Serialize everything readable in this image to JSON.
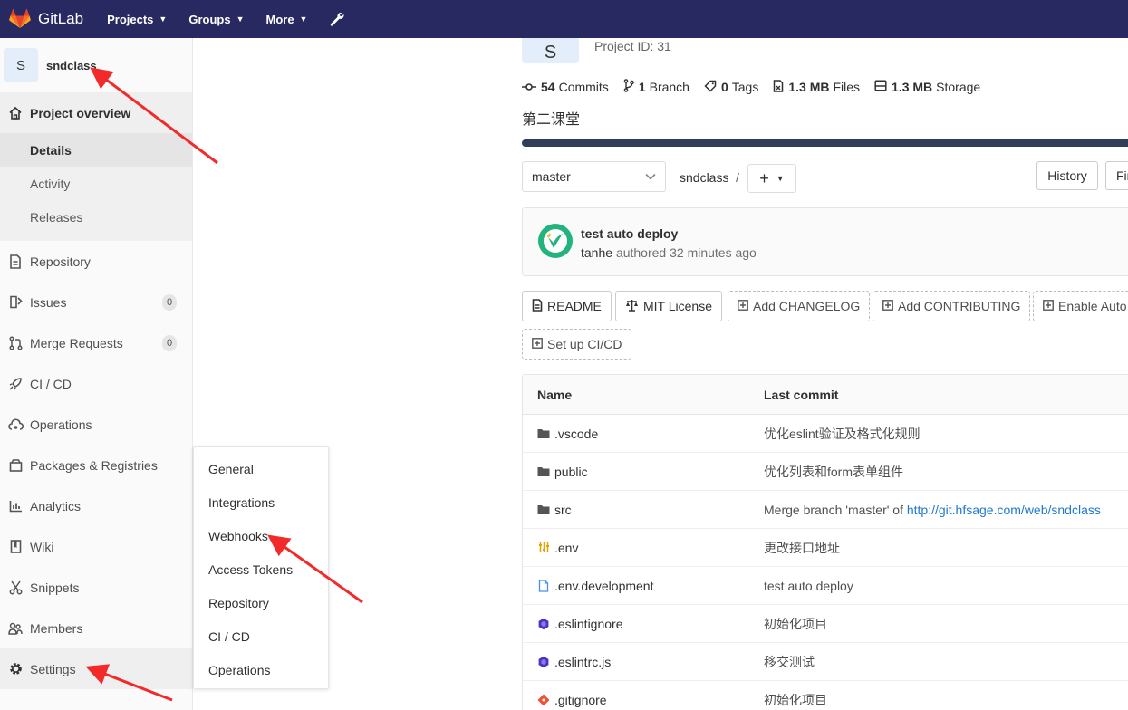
{
  "navbar": {
    "brand": "GitLab",
    "items": [
      {
        "label": "Projects"
      },
      {
        "label": "Groups"
      },
      {
        "label": "More"
      }
    ],
    "admin_icon": "wrench-icon"
  },
  "sidebar": {
    "avatar_letter": "S",
    "project_name": "sndclass",
    "overview": {
      "label": "Project overview",
      "subitems": [
        "Details",
        "Activity",
        "Releases"
      ]
    },
    "items": [
      {
        "label": "Repository",
        "icon": "document-icon"
      },
      {
        "label": "Issues",
        "icon": "issues-icon",
        "badge": "0"
      },
      {
        "label": "Merge Requests",
        "icon": "merge-request-icon",
        "badge": "0"
      },
      {
        "label": "CI / CD",
        "icon": "rocket-icon"
      },
      {
        "label": "Operations",
        "icon": "cloud-gear-icon"
      },
      {
        "label": "Packages & Registries",
        "icon": "package-icon"
      },
      {
        "label": "Analytics",
        "icon": "chart-icon"
      },
      {
        "label": "Wiki",
        "icon": "book-icon"
      },
      {
        "label": "Snippets",
        "icon": "scissors-icon"
      },
      {
        "label": "Members",
        "icon": "users-icon"
      },
      {
        "label": "Settings",
        "icon": "gear-icon"
      }
    ]
  },
  "settings_flyout": [
    "General",
    "Integrations",
    "Webhooks",
    "Access Tokens",
    "Repository",
    "CI / CD",
    "Operations"
  ],
  "project": {
    "avatar_letter": "S",
    "id_text": "Project ID: 31",
    "stats": [
      {
        "value": "54",
        "label": "Commits"
      },
      {
        "value": "1",
        "label": "Branch"
      },
      {
        "value": "0",
        "label": "Tags"
      },
      {
        "value": "1.3 MB",
        "label": "Files"
      },
      {
        "value": "1.3 MB",
        "label": "Storage"
      }
    ],
    "description": "第二课堂"
  },
  "repo_toolbar": {
    "branch": "master",
    "path": "sndclass",
    "separator": "/",
    "plus": "+",
    "history": "History",
    "find": "Fir"
  },
  "last_commit": {
    "title": "test auto deploy",
    "author": "tanhe",
    "action": "authored",
    "time": "32 minutes ago"
  },
  "quick_buttons": [
    {
      "label": "README",
      "style": "solid"
    },
    {
      "label": "MIT License",
      "style": "solid"
    },
    {
      "label": "Add CHANGELOG",
      "style": "dashed"
    },
    {
      "label": "Add CONTRIBUTING",
      "style": "dashed"
    },
    {
      "label": "Enable Auto",
      "style": "dashed"
    },
    {
      "label": "Set up CI/CD",
      "style": "dashed"
    }
  ],
  "file_table": {
    "headers": [
      "Name",
      "Last commit"
    ],
    "rows": [
      {
        "name": ".vscode",
        "type": "folder",
        "commit": "优化eslint验证及格式化规则"
      },
      {
        "name": "public",
        "type": "folder",
        "commit": "优化列表和form表单组件"
      },
      {
        "name": "src",
        "type": "folder",
        "commit": "Merge branch 'master' of ",
        "commit_link": "http://git.hfsage.com/web/sndclass"
      },
      {
        "name": ".env",
        "type": "env",
        "commit": "更改接口地址"
      },
      {
        "name": ".env.development",
        "type": "file",
        "commit": "test auto deploy"
      },
      {
        "name": ".eslintignore",
        "type": "eslint",
        "commit": "初始化项目"
      },
      {
        "name": ".eslintrc.js",
        "type": "eslint",
        "commit": "移交测试"
      },
      {
        "name": ".gitignore",
        "type": "git",
        "commit": "初始化项目"
      }
    ]
  },
  "colors": {
    "navbar": "#292961",
    "arrow": "#f22a2a",
    "link": "#1f78d1"
  }
}
